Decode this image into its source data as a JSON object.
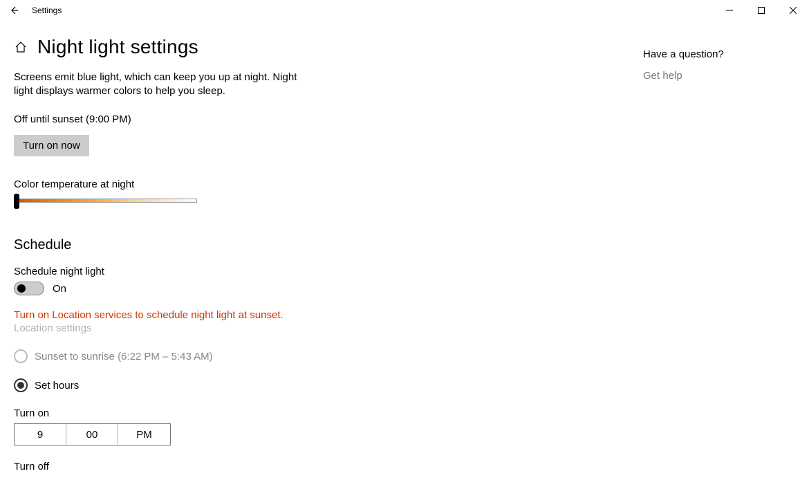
{
  "app_title": "Settings",
  "page_title": "Night light settings",
  "description": "Screens emit blue light, which can keep you up at night. Night light displays warmer colors to help you sleep.",
  "status_line": "Off until sunset (9:00 PM)",
  "turn_on_button": "Turn on now",
  "color_temp_label": "Color temperature at night",
  "color_temp_slider": {
    "min": 0,
    "max": 100,
    "value": 0
  },
  "schedule_heading": "Schedule",
  "schedule_toggle_label": "Schedule night light",
  "schedule_toggle_state": "On",
  "location_warning": "Turn on Location services to schedule night light at sunset.",
  "location_settings_link": "Location settings",
  "radio_sunset": {
    "label": "Sunset to sunrise (6:22 PM – 5:43 AM)",
    "enabled": false,
    "selected": false
  },
  "radio_set_hours": {
    "label": "Set hours",
    "enabled": true,
    "selected": true
  },
  "turn_on_label": "Turn on",
  "turn_on_time": {
    "hour": "9",
    "minute": "00",
    "ampm": "PM"
  },
  "turn_off_label": "Turn off",
  "side": {
    "question": "Have a question?",
    "help_link": "Get help"
  },
  "colors": {
    "warning": "#d13400",
    "button_bg": "#cccccc"
  }
}
